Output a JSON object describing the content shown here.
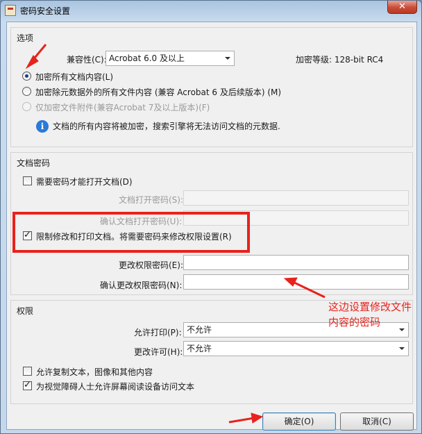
{
  "window": {
    "title": "密码安全设置",
    "close_symbol": "✕"
  },
  "options": {
    "group_title": "选项",
    "compat_label": "兼容性(C):",
    "compat_value": "Acrobat 6.0 及以上",
    "encryption_level": "加密等级: 128-bit RC4",
    "radio_all": "加密所有文档内容(L)",
    "radio_except_meta": "加密除元数据外的所有文件内容 (兼容 Acrobat 6 及后续版本) (M)",
    "radio_attachments": "仅加密文件附件(兼容Acrobat 7及以上版本)(F)",
    "info_text": "文档的所有内容将被加密，搜索引擎将无法访问文档的元数据.",
    "info_icon": "info-icon"
  },
  "doc_password": {
    "group_title": "文档密码",
    "require_open_label": "需要密码才能打开文档(D)",
    "open_password_label": "文档打开密码(S):",
    "confirm_open_label": "确认文档打开密码(U):",
    "restrict_label": "限制修改和打印文档。将需要密码来修改权限设置(R)",
    "change_perm_label": "更改权限密码(E):",
    "confirm_change_label": "确认更改权限密码(N):"
  },
  "permissions": {
    "group_title": "权限",
    "allow_print_label": "允许打印(P):",
    "allow_print_value": "不允许",
    "allow_change_label": "更改许可(H):",
    "allow_change_value": "不允许",
    "copy_label": "允许复制文本，图像和其他内容",
    "screen_reader_label": "为视觉障碍人士允许屏幕阅读设备访问文本"
  },
  "buttons": {
    "ok": "确定(O)",
    "cancel": "取消(C)"
  },
  "annotation": {
    "note": "这边设置修改文件内容的密码",
    "color": "#e8221c"
  }
}
